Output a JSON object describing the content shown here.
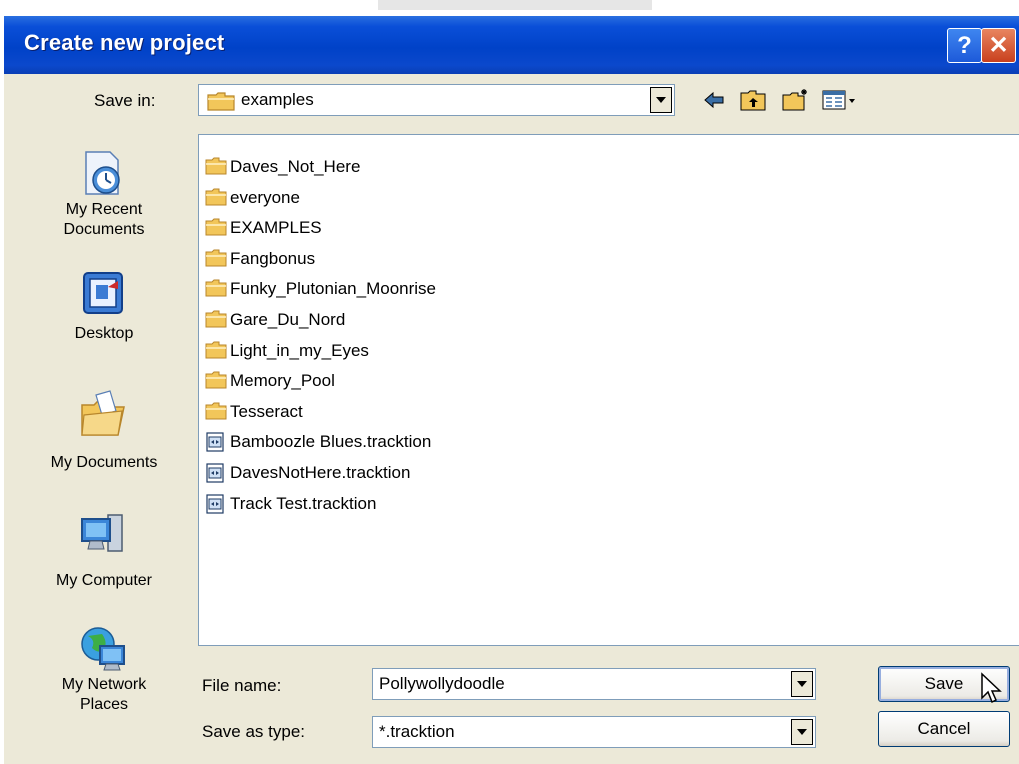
{
  "window": {
    "title": "Create new project"
  },
  "titlebar_buttons": {
    "help": "?",
    "close": "✕"
  },
  "save_in": {
    "label": "Save in:",
    "value": "examples"
  },
  "toolbar": {
    "icons": [
      "back-arrow-icon",
      "up-one-level-icon",
      "new-folder-icon",
      "views-menu-icon"
    ]
  },
  "places_bar": [
    {
      "label_lines": [
        "My Recent",
        "Documents"
      ],
      "icon": "recent-documents-icon"
    },
    {
      "label_lines": [
        "Desktop"
      ],
      "icon": "desktop-icon"
    },
    {
      "label_lines": [
        "My Documents"
      ],
      "icon": "my-documents-icon"
    },
    {
      "label_lines": [
        "My Computer"
      ],
      "icon": "my-computer-icon"
    },
    {
      "label_lines": [
        "My Network",
        "Places"
      ],
      "icon": "network-places-icon"
    }
  ],
  "files": [
    {
      "name": "Daves_Not_Here",
      "type": "folder"
    },
    {
      "name": "everyone",
      "type": "folder"
    },
    {
      "name": "EXAMPLES",
      "type": "folder"
    },
    {
      "name": "Fangbonus",
      "type": "folder"
    },
    {
      "name": "Funky_Plutonian_Moonrise",
      "type": "folder"
    },
    {
      "name": "Gare_Du_Nord",
      "type": "folder"
    },
    {
      "name": "Light_in_my_Eyes",
      "type": "folder"
    },
    {
      "name": "Memory_Pool",
      "type": "folder"
    },
    {
      "name": "Tesseract",
      "type": "folder"
    },
    {
      "name": "Bamboozle Blues.tracktion",
      "type": "file"
    },
    {
      "name": "DavesNotHere.tracktion",
      "type": "file"
    },
    {
      "name": "Track Test.tracktion",
      "type": "file"
    }
  ],
  "file_name": {
    "label": "File name:",
    "value": "Pollywollydoodle"
  },
  "save_as_type": {
    "label": "Save as type:",
    "value": "*.tracktion"
  },
  "buttons": {
    "save": "Save",
    "cancel": "Cancel"
  },
  "colors": {
    "titlebar": "#0042c8",
    "dialog_bg": "#ece9d8",
    "folder": "#f2c65a"
  }
}
